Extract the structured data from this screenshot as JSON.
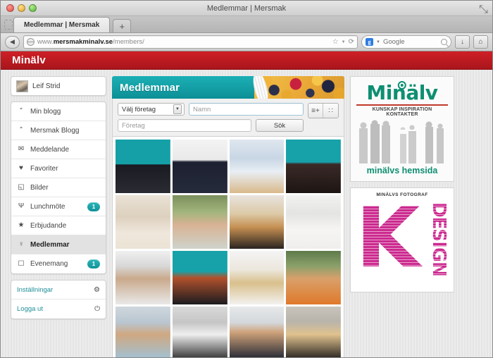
{
  "browser": {
    "window_title": "Medlemmar | Mersmak",
    "tab_title": "Medlemmar | Mersmak",
    "new_tab_label": "+",
    "url_prefix": "www.",
    "url_domain": "mersmakminalv.se",
    "url_path": "/members/",
    "search_engine": "Google",
    "search_engine_mark": "g",
    "back_glyph": "◀",
    "bookmark_glyph": "☆",
    "dropdown_glyph": "▼",
    "reload_glyph": "⟳",
    "download_glyph": "↓",
    "home_glyph": "⌂",
    "fullscreen_glyph": "⤡"
  },
  "site": {
    "brand": "Minälv"
  },
  "sidebar": {
    "user": {
      "name": "Leif Strid",
      "avatar": "user-avatar"
    },
    "items": [
      {
        "label": "Min blogg",
        "icon": "quote-icon",
        "icon_glyph": "”",
        "badge": "",
        "active": false
      },
      {
        "label": "Mersmak Blogg",
        "icon": "quote-icon",
        "icon_glyph": "”",
        "badge": "",
        "active": false
      },
      {
        "label": "Meddelande",
        "icon": "message-icon",
        "icon_glyph": "✉",
        "badge": "",
        "active": false
      },
      {
        "label": "Favoriter",
        "icon": "heart-icon",
        "icon_glyph": "♥",
        "badge": "",
        "active": false
      },
      {
        "label": "Bilder",
        "icon": "camera-icon",
        "icon_glyph": "◱",
        "badge": "",
        "active": false
      },
      {
        "label": "Lunchmöte",
        "icon": "cutlery-icon",
        "icon_glyph": "Ψ",
        "badge": "1",
        "active": false
      },
      {
        "label": "Erbjudande",
        "icon": "star-icon",
        "icon_glyph": "★",
        "badge": "",
        "active": false
      },
      {
        "label": "Medlemmar",
        "icon": "person-icon",
        "icon_glyph": "♀",
        "badge": "",
        "active": true
      },
      {
        "label": "Evenemang",
        "icon": "calendar-icon",
        "icon_glyph": "☐",
        "badge": "1",
        "active": false
      }
    ],
    "links": [
      {
        "label": "Inställningar",
        "icon": "gear-icon",
        "icon_glyph": "⚙"
      },
      {
        "label": "Logga ut",
        "icon": "power-icon",
        "icon_glyph": "⏻"
      }
    ]
  },
  "main": {
    "title": "Medlemmar",
    "banner": "food-cereal-berries-banner",
    "filters": {
      "company_select_value": "Välj företag",
      "company_select_options": [
        "Välj företag"
      ],
      "name_placeholder": "Namn",
      "name_value": "",
      "company_placeholder": "Företag",
      "company_value": "",
      "search_button": "Sök"
    },
    "view_buttons": [
      {
        "name": "list-view-button",
        "glyph": "≡+"
      },
      {
        "name": "grid-view-button",
        "glyph": "∷"
      }
    ],
    "members": [
      {
        "name": "member-photo-1",
        "css": "linear-gradient(#15a0a8,#15a0a8 46%,#1a1a22 47%,#2b2b33 100%)"
      },
      {
        "name": "member-photo-2",
        "css": "linear-gradient(#f3f3f3,#e9e9e9 38%,#1c2030 42%,#262b3c 100%)"
      },
      {
        "name": "member-photo-3",
        "css": "linear-gradient(#dfe7ef,#c8d6e4 35%,#e8eef4 60%,#d9b98a 100%)"
      },
      {
        "name": "member-photo-4",
        "css": "linear-gradient(#17a2aa,#17a2aa 42%,#3a2a28 46%,#1d1512 100%)"
      },
      {
        "name": "member-photo-5",
        "css": "linear-gradient(#e9e2d6,#ddd0be 40%,#efe7dc 70%,#ece3d6 100%)"
      },
      {
        "name": "member-photo-6",
        "css": "linear-gradient(#7b8f5c,#a3b57d 32%,#d8b293 55%,#cfd3cc 100%)"
      },
      {
        "name": "member-photo-7",
        "css": "linear-gradient(#e8e4de,#dcc9a6 35%,#c58f52 60%,#2a2420 100%)"
      },
      {
        "name": "member-photo-8",
        "css": "linear-gradient(#f1f1ef,#e4e4e2 35%,#f6f5f3 65%,#efeeec 100%)"
      },
      {
        "name": "member-photo-9",
        "css": "linear-gradient(#f0f0f0,#d8d8d8 28%,#c9a98c 52%,#e9e9e9 100%)"
      },
      {
        "name": "member-photo-10",
        "css": "linear-gradient(#16a2a8,#16a2a8 38%,#b2522c 50%,#1b1b1f 100%)"
      },
      {
        "name": "member-photo-11",
        "css": "linear-gradient(#f4f4f4,#ece7dd 35%,#d9c08c 60%,#f2f1ef 100%)"
      },
      {
        "name": "member-photo-12",
        "css": "linear-gradient(#5f7a4a,#8aa06a 28%,#d9a06a 52%,#e0792a 100%)"
      },
      {
        "name": "member-photo-13",
        "css": "linear-gradient(#cfd7dd,#b9c6d0 30%,#cfa882 52%,#9fc2d8 100%)"
      },
      {
        "name": "member-photo-14",
        "css": "linear-gradient(#d8d8d8,#c6c6c6 30%,#efefef 52%,#2b2b2b 100%)"
      },
      {
        "name": "member-photo-15",
        "css": "linear-gradient(#e6e8ea,#d4d8dc 30%,#cfa27a 48%,#1c2230 100%)"
      },
      {
        "name": "member-photo-16",
        "css": "linear-gradient(#c9c4bb,#b9b4ab 28%,#e0c28e 52%,#1f1d1b 100%)"
      }
    ]
  },
  "ads": [
    {
      "name": "minalv-ad",
      "logo": "Minälv",
      "tagline": "KUNSKAP  INSPIRATION  KONTAKTER",
      "footer": "minälvs hemsida",
      "art": "people-silhouettes"
    },
    {
      "name": "xl-design-ad",
      "tag": "MINÄLVS FOTOGRAF",
      "mark": "K",
      "word": "DESIGN",
      "color": "#cc2a8f"
    }
  ]
}
